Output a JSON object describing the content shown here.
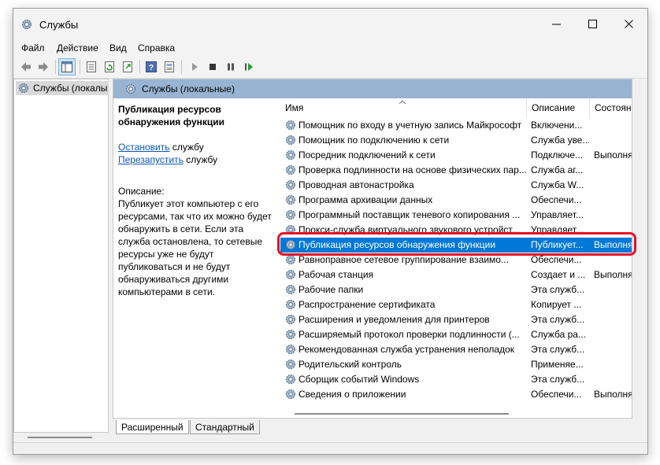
{
  "window": {
    "title": "Службы"
  },
  "menu": [
    "Файл",
    "Действие",
    "Вид",
    "Справка"
  ],
  "tree": {
    "root_label": "Службы (локалы"
  },
  "main": {
    "header": "Службы (локальные)"
  },
  "details": {
    "service_name": "Публикация ресурсов обнаружения функции",
    "actions": [
      {
        "link": "Остановить",
        "suffix": " службу"
      },
      {
        "link": "Перезапустить",
        "suffix": " службу"
      }
    ],
    "desc_label": "Описание:",
    "description": "Публикует этот компьютер с его ресурсами, так что их можно будет обнаружить в сети.  Если эта служба остановлена, то сетевые ресурсы уже не будут публиковаться и не будут обнаруживаться другими компьютерами в сети."
  },
  "columns": {
    "name": "Имя",
    "desc": "Описание",
    "state": "Состоян"
  },
  "rows": [
    {
      "name": "Помощник по входу в учетную запись Майкрософт",
      "desc": "Включени...",
      "state": ""
    },
    {
      "name": "Помощник по подключению к сети",
      "desc": "Служба уве...",
      "state": ""
    },
    {
      "name": "Посредник подключений к сети",
      "desc": "Подключе...",
      "state": "Выполня"
    },
    {
      "name": "Проверка подлинности на основе физических пар...",
      "desc": "Служба аг...",
      "state": ""
    },
    {
      "name": "Проводная автонастройка",
      "desc": "Служба W...",
      "state": ""
    },
    {
      "name": "Программа архивации данных",
      "desc": "Обеспечи...",
      "state": ""
    },
    {
      "name": "Программный поставщик теневого копирования ...",
      "desc": "Управляет...",
      "state": ""
    },
    {
      "name": "Прокси-служба виртуального звукового устройст...",
      "desc": "Управляет...",
      "state": ""
    },
    {
      "name": "Публикация ресурсов обнаружения функции",
      "desc": "Публикует...",
      "state": "Выполня",
      "selected": true
    },
    {
      "name": "Равноправное сетевое группирование взаимо...",
      "desc": "Обеспечи...",
      "state": ""
    },
    {
      "name": "Рабочая станция",
      "desc": "Создает и ...",
      "state": "Выполня"
    },
    {
      "name": "Рабочие папки",
      "desc": "Эта служб...",
      "state": ""
    },
    {
      "name": "Распространение сертификата",
      "desc": "Копирует ...",
      "state": ""
    },
    {
      "name": "Расширения и уведомления для принтеров",
      "desc": "Эта служб...",
      "state": ""
    },
    {
      "name": "Расширяемый протокол проверки подлинности (...",
      "desc": "Служба ра...",
      "state": ""
    },
    {
      "name": "Рекомендованная служба устранения неполадок",
      "desc": "Эта служб...",
      "state": ""
    },
    {
      "name": "Родительский контроль",
      "desc": "Применяе...",
      "state": ""
    },
    {
      "name": "Сборщик событий Windows",
      "desc": "Эта служб...",
      "state": ""
    },
    {
      "name": "Сведения о приложении",
      "desc": "Обеспечи...",
      "state": "Выполня"
    }
  ],
  "tabs": [
    "Расширенный",
    "Стандартный"
  ],
  "colors": {
    "accent": "#0078d7",
    "highlight": "#e81123",
    "header": "#98b4d2"
  }
}
